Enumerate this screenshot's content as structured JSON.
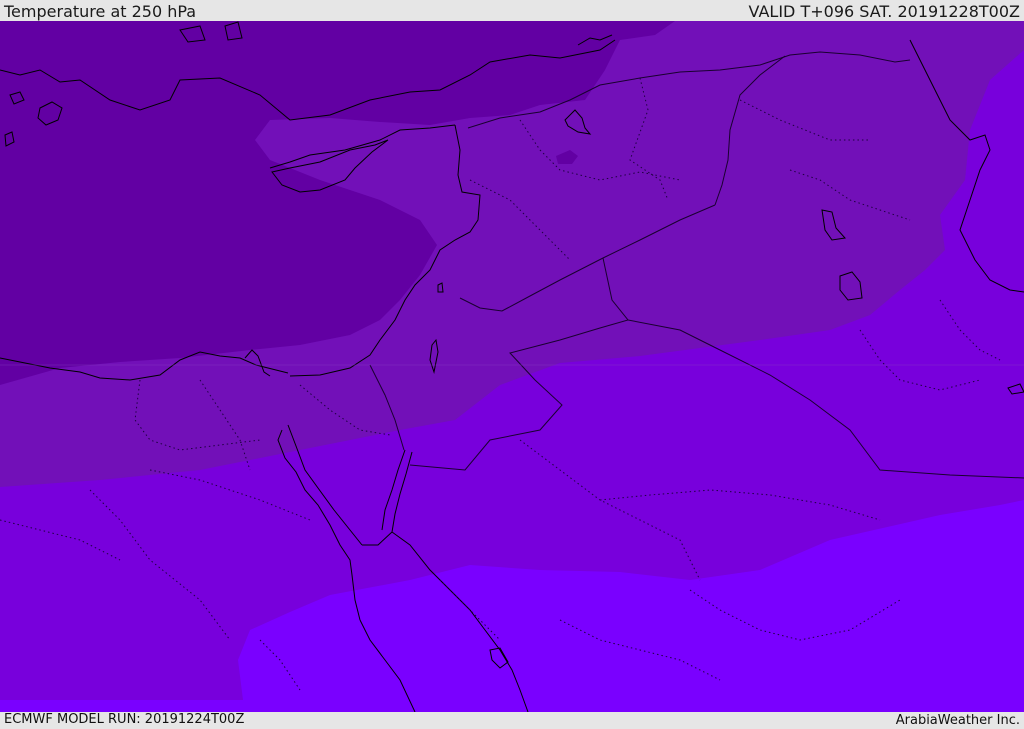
{
  "header": {
    "title": "Temperature at 250 hPa",
    "valid": "VALID T+096 SAT. 20191228T00Z"
  },
  "footer": {
    "model_run": "ECMWF MODEL RUN: 20191224T00Z",
    "credit": "ArabiaWeather Inc."
  },
  "colors": {
    "band_coldest": "#6200a3",
    "band_cold": "#7210b8",
    "band_mid": "#7800dc",
    "band_warm": "#7a00ff",
    "coastline": "#000000",
    "borders": "#1a0030",
    "header_bg": "#e6e6e6",
    "text": "#1a1a1a"
  }
}
